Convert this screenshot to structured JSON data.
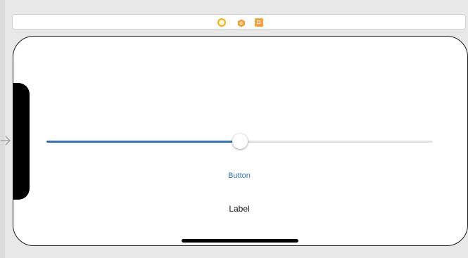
{
  "scene_dock": {
    "icons": [
      "view-controller-icon",
      "first-responder-icon",
      "exit-icon"
    ]
  },
  "view": {
    "slider": {
      "value": 0.5,
      "min_track_color": "#2f72c1",
      "max_track_color": "#e2e2e2"
    },
    "button": {
      "label": "Button",
      "color": "#2f72c1"
    },
    "label": {
      "text": "Label"
    }
  }
}
